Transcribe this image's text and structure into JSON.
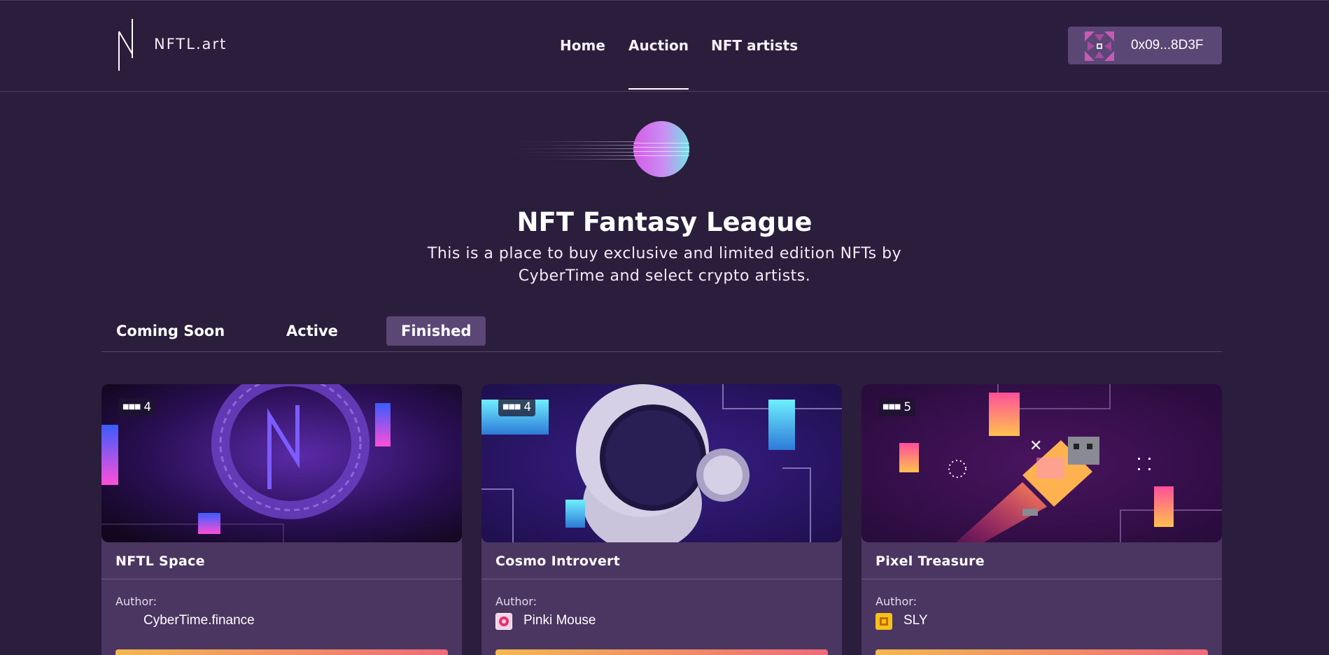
{
  "header": {
    "logo_text": "NFTL.art",
    "nav": [
      "Home",
      "Auction",
      "NFT artists"
    ],
    "active_nav": "Auction",
    "wallet_address": "0x09...8D3F"
  },
  "hero": {
    "title": "NFT Fantasy League",
    "description": "This is a place to buy exclusive and limited edition NFTs by CyberTime and select crypto artists."
  },
  "tabs": {
    "items": [
      "Coming Soon",
      "Active",
      "Finished"
    ],
    "active": "Finished"
  },
  "cards": [
    {
      "title": "NFTL Space",
      "count": "4",
      "author_label": "Author:",
      "author": "CyberTime.finance",
      "avatar_icon": "none"
    },
    {
      "title": "Cosmo Introvert",
      "count": "4",
      "author_label": "Author:",
      "author": "Pinki Mouse",
      "avatar_icon": "pink-flower-icon"
    },
    {
      "title": "Pixel Treasure",
      "count": "5",
      "author_label": "Author:",
      "author": "SLY",
      "avatar_icon": "yellow-sly-icon"
    }
  ],
  "colors": {
    "background": "#2b1d3c",
    "card": "#4a3660",
    "active_tab": "#5b4775",
    "bar_start": "#f2b84f",
    "bar_end": "#ee6b79"
  }
}
